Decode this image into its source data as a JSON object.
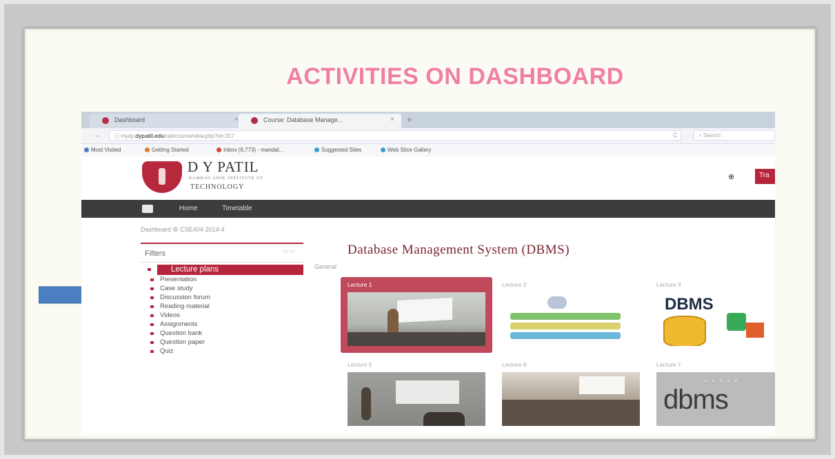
{
  "slide": {
    "title": "ACTIVITIES ON DASHBOARD"
  },
  "browser": {
    "tabs": [
      {
        "label": "Dashboard",
        "close": "×"
      },
      {
        "label": "Course: Database Manage...",
        "close": "×"
      }
    ],
    "new_tab": "+",
    "back": "←",
    "url_prefix": "ⓘ  mydy.",
    "url_domain": "dypatil.edu",
    "url_suffix": "/rait/course/view.php?id=317",
    "reload": "C",
    "search_placeholder": "Search",
    "bookmarks": [
      {
        "label": "Most Visited",
        "color": "#4a7fc1"
      },
      {
        "label": "Getting Started",
        "color": "#e07a2a"
      },
      {
        "label": "Inbox (6,773) - mandal...",
        "color": "#d44638"
      },
      {
        "label": "Suggested Sites",
        "color": "#3c9bd6"
      },
      {
        "label": "Web Slice Gallery",
        "color": "#3c9bd6"
      }
    ]
  },
  "header": {
    "logo_main": "D Y PATIL",
    "logo_sub": "RAMRAO ADIK INSTITUTE OF",
    "logo_tech": "TECHNOLOGY",
    "settings_icon": "⊕",
    "button_label": "Tra"
  },
  "nav": {
    "items": [
      "Home",
      "Timetable"
    ]
  },
  "breadcrumb": {
    "text": "Dashboard  ⚙  CSE404-2014-4"
  },
  "filters": {
    "title": "Filters",
    "controls": "▭ ▭",
    "items": [
      "Lecture plans",
      "Presentation",
      "Case study",
      "Discussion forum",
      "Reading material",
      "Videos",
      "Assignments",
      "Question bank",
      "Question paper",
      "Quiz"
    ],
    "selected_index": 0
  },
  "course": {
    "title": "Database Management System (DBMS)",
    "section": "General",
    "cards": [
      {
        "label": "Lecture 1"
      },
      {
        "label": "Lecture 2"
      },
      {
        "label": "Lecture 3"
      },
      {
        "label": "Lecture 5"
      },
      {
        "label": "Lecture 6"
      },
      {
        "label": "Lecture 7"
      }
    ],
    "dbms_logo": "DBMS",
    "dbms_logo2": "dbms"
  },
  "colors": {
    "brand": "#b6253b",
    "slide_title": "#f07fa5",
    "arrow": "#4a7fc1"
  }
}
